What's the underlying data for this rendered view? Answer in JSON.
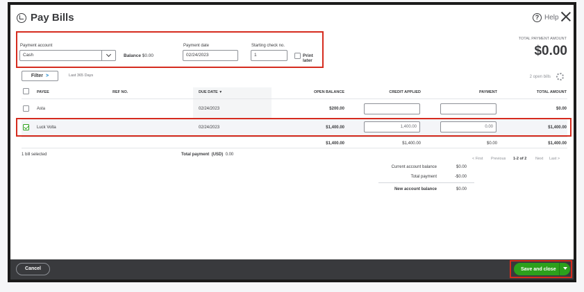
{
  "header": {
    "title": "Pay Bills",
    "help_label": "Help"
  },
  "form": {
    "payment_account_label": "Payment account",
    "payment_account_value": "Cash",
    "balance_label": "Balance",
    "balance_value": "$0.00",
    "payment_date_label": "Payment date",
    "payment_date_value": "02/24/2023",
    "check_no_label": "Starting check no.",
    "check_no_value": "1",
    "print_later_label": "Print later"
  },
  "total": {
    "label": "TOTAL PAYMENT AMOUNT",
    "amount": "$0.00"
  },
  "filter": {
    "button_label": "Filter",
    "chevron": ">",
    "range": "Last 365 Days",
    "open_bills": "2 open bills"
  },
  "table": {
    "columns": [
      "PAYEE",
      "REF NO.",
      "DUE DATE",
      "OPEN BALANCE",
      "CREDIT APPLIED",
      "PAYMENT",
      "TOTAL AMOUNT"
    ],
    "sort_indicator": "▼",
    "rows": [
      {
        "payee": "Asta",
        "ref": "",
        "due": "02/24/2023",
        "open_balance": "$200.00",
        "credit": "",
        "payment": "",
        "total": "$0.00",
        "checked": false
      },
      {
        "payee": "Luck Volta",
        "ref": "",
        "due": "02/24/2023",
        "open_balance": "$1,400.00",
        "credit": "1,400.00",
        "payment": "0.00",
        "total": "$1,400.00",
        "checked": true
      }
    ],
    "totals": {
      "open_balance": "$1,400.00",
      "credit": "$1,400.00",
      "payment": "$0.00",
      "total": "$1,400.00"
    }
  },
  "selection": {
    "count_text": "1 bill selected",
    "total_label": "Total payment",
    "currency": "(USD)",
    "total_value": "0.00"
  },
  "pagination": {
    "first": "< First",
    "previous": "Previous",
    "range": "1-2 of 2",
    "next": "Next",
    "last": "Last >"
  },
  "summary": {
    "current_label": "Current account balance",
    "current_value": "$0.00",
    "payment_label": "Total payment",
    "payment_value": "-$0.00",
    "new_label": "New account balance",
    "new_value": "$0.00"
  },
  "footer": {
    "cancel_label": "Cancel",
    "save_label": "Save and close"
  },
  "colors": {
    "accent_green": "#2ca01c",
    "highlight_red": "#d52b1e",
    "footer_bg": "#393a3d"
  }
}
